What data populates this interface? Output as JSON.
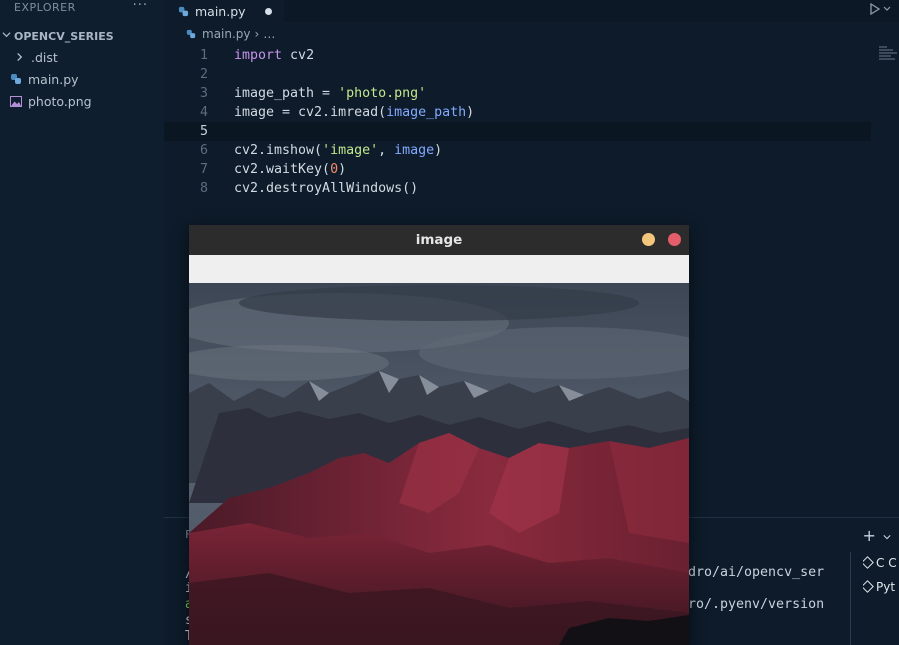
{
  "sidebar": {
    "header": "EXPLORER",
    "more": "···",
    "folder": "OPENCV_SERIES",
    "items": [
      {
        "label": ".dist",
        "icon": "chevron-right-icon"
      },
      {
        "label": "main.py",
        "icon": "python-icon"
      },
      {
        "label": "photo.png",
        "icon": "image-icon"
      }
    ]
  },
  "editor": {
    "tab": {
      "label": "main.py",
      "modified": true
    },
    "breadcrumb": {
      "file": "main.py",
      "sep": "›",
      "rest": "…"
    },
    "lines": [
      {
        "n": "1"
      },
      {
        "n": "2"
      },
      {
        "n": "3"
      },
      {
        "n": "4"
      },
      {
        "n": "5"
      },
      {
        "n": "6"
      },
      {
        "n": "7"
      },
      {
        "n": "8"
      }
    ],
    "code": {
      "l1_kw": "import",
      "l1_rest": " cv2",
      "l3_a": "image_path = ",
      "l3_str": "'photo.png'",
      "l4_a": "image = cv2.imread(",
      "l4_var": "image_path",
      "l4_b": ")",
      "l6_a": "cv2.imshow(",
      "l6_str": "'image'",
      "l6_b": ", ",
      "l6_var": "image",
      "l6_c": ")",
      "l7_a": "cv2.waitKey(",
      "l7_num": "0",
      "l7_b": ")",
      "l8": "cv2.destroyAllWindows()"
    }
  },
  "terminal": {
    "left_fragments": [
      "F",
      "/",
      "i",
      "a",
      "s",
      "T"
    ],
    "line1": "dro/ai/opencv_ser",
    "line2": "ro/.pyenv/version",
    "plus": "+",
    "list": [
      "C C",
      "Pyt"
    ]
  },
  "cv_window": {
    "title": "image"
  },
  "colors": {
    "keyword": "#c792ea",
    "string": "#c3e88d",
    "variable": "#82aaff",
    "number": "#f78c6c",
    "background": "#0d1b2a"
  }
}
